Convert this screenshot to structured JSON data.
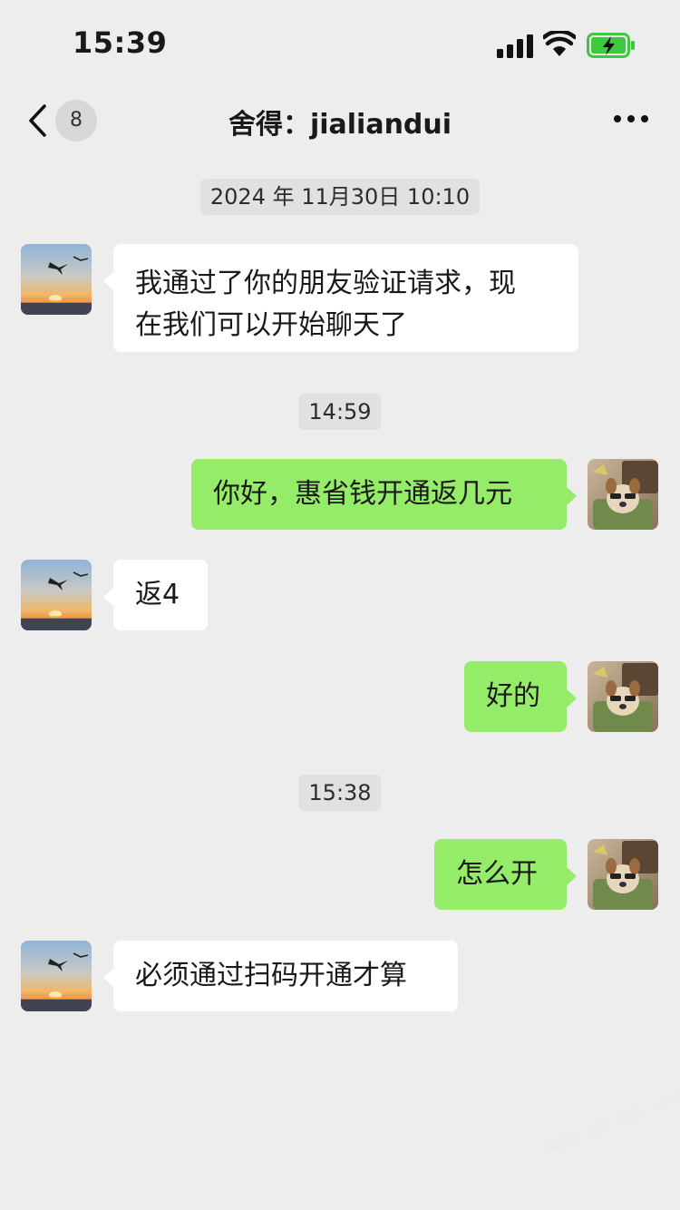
{
  "status_bar": {
    "time": "15:39"
  },
  "nav": {
    "unread_count": "8",
    "title": "舍得：jialiandui"
  },
  "timestamps": [
    "2024 年 11月30日 10:10",
    "14:59",
    "15:38"
  ],
  "messages": [
    {
      "side": "in",
      "lines": [
        "我通过了你的朋友验证请求，现",
        "在我们可以开始聊天了"
      ]
    },
    {
      "side": "out",
      "text": "你好，惠省钱开通返几元"
    },
    {
      "side": "in",
      "text": "返4"
    },
    {
      "side": "out",
      "text": "好的"
    },
    {
      "side": "out",
      "text": "怎么开"
    },
    {
      "side": "in",
      "text": "必须通过扫码开通才算"
    }
  ],
  "watermark": "赚客吧，有奖一起赚！ www.zuanke8.com",
  "colors": {
    "background": "#ededed",
    "incoming_bubble": "#ffffff",
    "outgoing_bubble": "#95ec69",
    "battery": "#3fc83f"
  },
  "icons": [
    "signal-icon",
    "wifi-icon",
    "battery-charging-icon",
    "back-chevron-icon",
    "more-icon"
  ]
}
